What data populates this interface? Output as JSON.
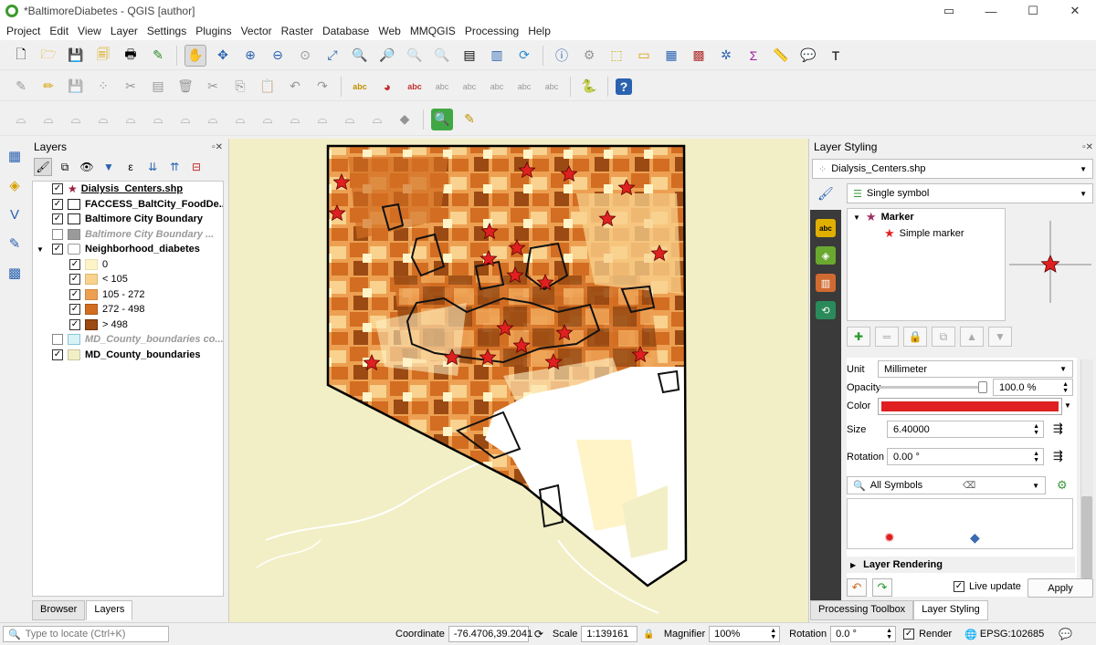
{
  "window": {
    "title": "*BaltimoreDiabetes - QGIS [author]"
  },
  "menu": [
    "Project",
    "Edit",
    "View",
    "Layer",
    "Settings",
    "Plugins",
    "Vector",
    "Raster",
    "Database",
    "Web",
    "MMQGIS",
    "Processing",
    "Help"
  ],
  "toolbars": {
    "row1": [
      "new-project-icon",
      "open-project-icon",
      "save-project-icon",
      "save-as-icon",
      "print-layout-icon",
      "style-manager-icon",
      "pan-icon",
      "pan-to-selection-icon",
      "zoom-in-icon",
      "zoom-out-icon",
      "zoom-native-icon",
      "zoom-full-icon",
      "zoom-to-selection-icon",
      "zoom-to-layer-icon",
      "zoom-last-icon",
      "zoom-next-icon",
      "new-map-view-icon",
      "new-bookmark-icon",
      "refresh-icon",
      "identify-icon",
      "action-icon",
      "select-feature-icon",
      "deselect-icon",
      "attribute-table-icon",
      "field-calculator-icon",
      "statistics-icon",
      "sum-icon",
      "measure-icon",
      "map-tips-icon",
      "text-annotation-icon"
    ],
    "row2": [
      "current-edits-icon",
      "toggle-edit-icon",
      "save-edits-icon",
      "digitize-icon",
      "vertex-tool-icon",
      "modify-attributes-icon",
      "delete-selected-icon",
      "cut-icon",
      "copy-icon",
      "paste-icon",
      "undo-icon",
      "redo-icon",
      "label-tool-icon",
      "diagram-tool-icon",
      "highlight-label-icon",
      "pin-label-icon",
      "show-hide-label-icon",
      "move-label-icon",
      "rotate-label-icon",
      "change-label-icon",
      "python-console-icon",
      "help-icon"
    ],
    "row3": [
      "offset-curve-icon",
      "reshape-icon",
      "split-icon",
      "merge-icon",
      "rotate-feature-icon",
      "simplify-icon",
      "add-ring-icon",
      "add-part-icon",
      "fill-ring-icon",
      "delete-ring-icon",
      "delete-part-icon",
      "offset-icon",
      "split-parts-icon",
      "merge-attributes-icon",
      "node-icon",
      "zoom-tool-icon",
      "georef-icon"
    ]
  },
  "left_tools": [
    "data-source-manager-icon",
    "add-layer-icon",
    "digitize-vector-icon",
    "add-delimited-icon",
    "add-raster-icon"
  ],
  "layers_panel": {
    "title": "Layers",
    "items": [
      {
        "label": "Dialysis_Centers.shp",
        "checked": true,
        "style": "bold-underline",
        "swatch": "star"
      },
      {
        "label": "FACCESS_BaltCity_FoodDe...",
        "checked": true,
        "style": "bold",
        "swatch": "empty"
      },
      {
        "label": "Baltimore City Boundary",
        "checked": true,
        "style": "bold",
        "swatch": "empty"
      },
      {
        "label": "Baltimore City Boundary ...",
        "checked": false,
        "style": "grey",
        "swatch": "grey"
      },
      {
        "label": "Neighborhood_diabetes",
        "checked": true,
        "style": "bold",
        "swatch": "polygon"
      },
      {
        "label": "0",
        "checked": true,
        "style": "class",
        "swatch": "#fff4c8"
      },
      {
        "label": "< 105",
        "checked": true,
        "style": "class",
        "swatch": "#f8d28e"
      },
      {
        "label": "105 - 272",
        "checked": true,
        "style": "class",
        "swatch": "#eda052"
      },
      {
        "label": "272 - 498",
        "checked": true,
        "style": "class",
        "swatch": "#d26d22"
      },
      {
        "label": "> 498",
        "checked": true,
        "style": "class",
        "swatch": "#9a4a12"
      },
      {
        "label": "MD_County_boundaries co...",
        "checked": false,
        "style": "grey",
        "swatch": "#d8f2f6"
      },
      {
        "label": "MD_County_boundaries",
        "checked": true,
        "style": "bold",
        "swatch": "#f2efc6"
      }
    ],
    "tabs": [
      "Browser",
      "Layers"
    ],
    "active_tab": "Layers"
  },
  "styling_panel": {
    "title": "Layer Styling",
    "layer_select": "Dialysis_Centers.shp",
    "renderer": "Single symbol",
    "symbol_tree": {
      "root": "Marker",
      "child": "Simple marker"
    },
    "unit_label": "Unit",
    "unit": "Millimeter",
    "opacity_label": "Opacity",
    "opacity": "100.0 %",
    "color_label": "Color",
    "color": "#e02020",
    "size_label": "Size",
    "size": "6.40000",
    "rotation_label": "Rotation",
    "rotation": "0.00 °",
    "symbols_filter": "All Symbols",
    "layer_rendering": "Layer Rendering",
    "live_update_label": "Live update",
    "live_update": true,
    "apply_label": "Apply",
    "tabs": [
      "Processing Toolbox",
      "Layer Styling"
    ],
    "active_tab": "Layer Styling"
  },
  "statusbar": {
    "locate_placeholder": "Type to locate (Ctrl+K)",
    "coordinate_label": "Coordinate",
    "coordinate": "-76.4706,39.2041",
    "scale_label": "Scale",
    "scale": "1:139161",
    "magnifier_label": "Magnifier",
    "magnifier": "100%",
    "rotation_label": "Rotation",
    "rotation": "0.0 °",
    "render_label": "Render",
    "render": true,
    "crs": "EPSG:102685"
  },
  "colors": {
    "accent_red": "#e02020",
    "map_background": "#f2efc6",
    "choropleth": [
      "#fff4c8",
      "#f8d28e",
      "#eda052",
      "#d26d22",
      "#9a4a12"
    ]
  }
}
